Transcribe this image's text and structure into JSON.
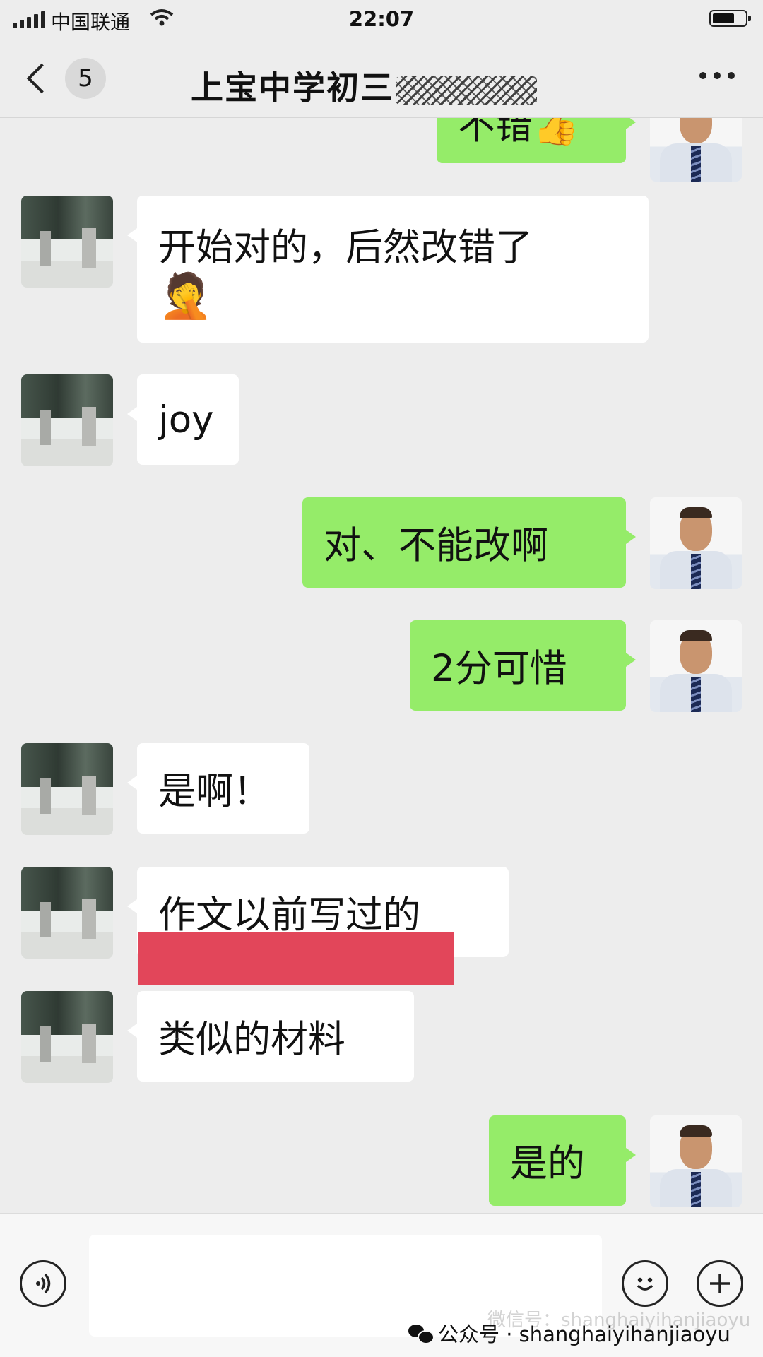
{
  "status_bar": {
    "carrier": "中国联通",
    "time": "22:07"
  },
  "nav": {
    "unread_count": "5",
    "title": "上宝中学初三"
  },
  "messages": [
    {
      "sender": "self",
      "text": "不错👍"
    },
    {
      "sender": "other",
      "text": "开始对的，后然改错了",
      "emoji": "🤦"
    },
    {
      "sender": "other",
      "text": "joy"
    },
    {
      "sender": "self",
      "text": "对、不能改啊"
    },
    {
      "sender": "self",
      "text": "2分可惜"
    },
    {
      "sender": "other",
      "text": "是啊！"
    },
    {
      "sender": "other",
      "text": "作文以前写过的"
    },
    {
      "sender": "other",
      "text": "类似的材料"
    },
    {
      "sender": "self",
      "text": "是的"
    }
  ],
  "input": {
    "emoji_icon": "emoji-icon",
    "plus_icon": "plus-icon"
  },
  "watermark": {
    "label": "公众号 · shanghaiyihanjiaoyu",
    "faint": "微信号：shanghaiyihanjiaoyu"
  },
  "colors": {
    "self_bubble": "#95ec69",
    "other_bubble": "#ffffff",
    "background": "#ededed",
    "redaction": "#e2465a"
  }
}
